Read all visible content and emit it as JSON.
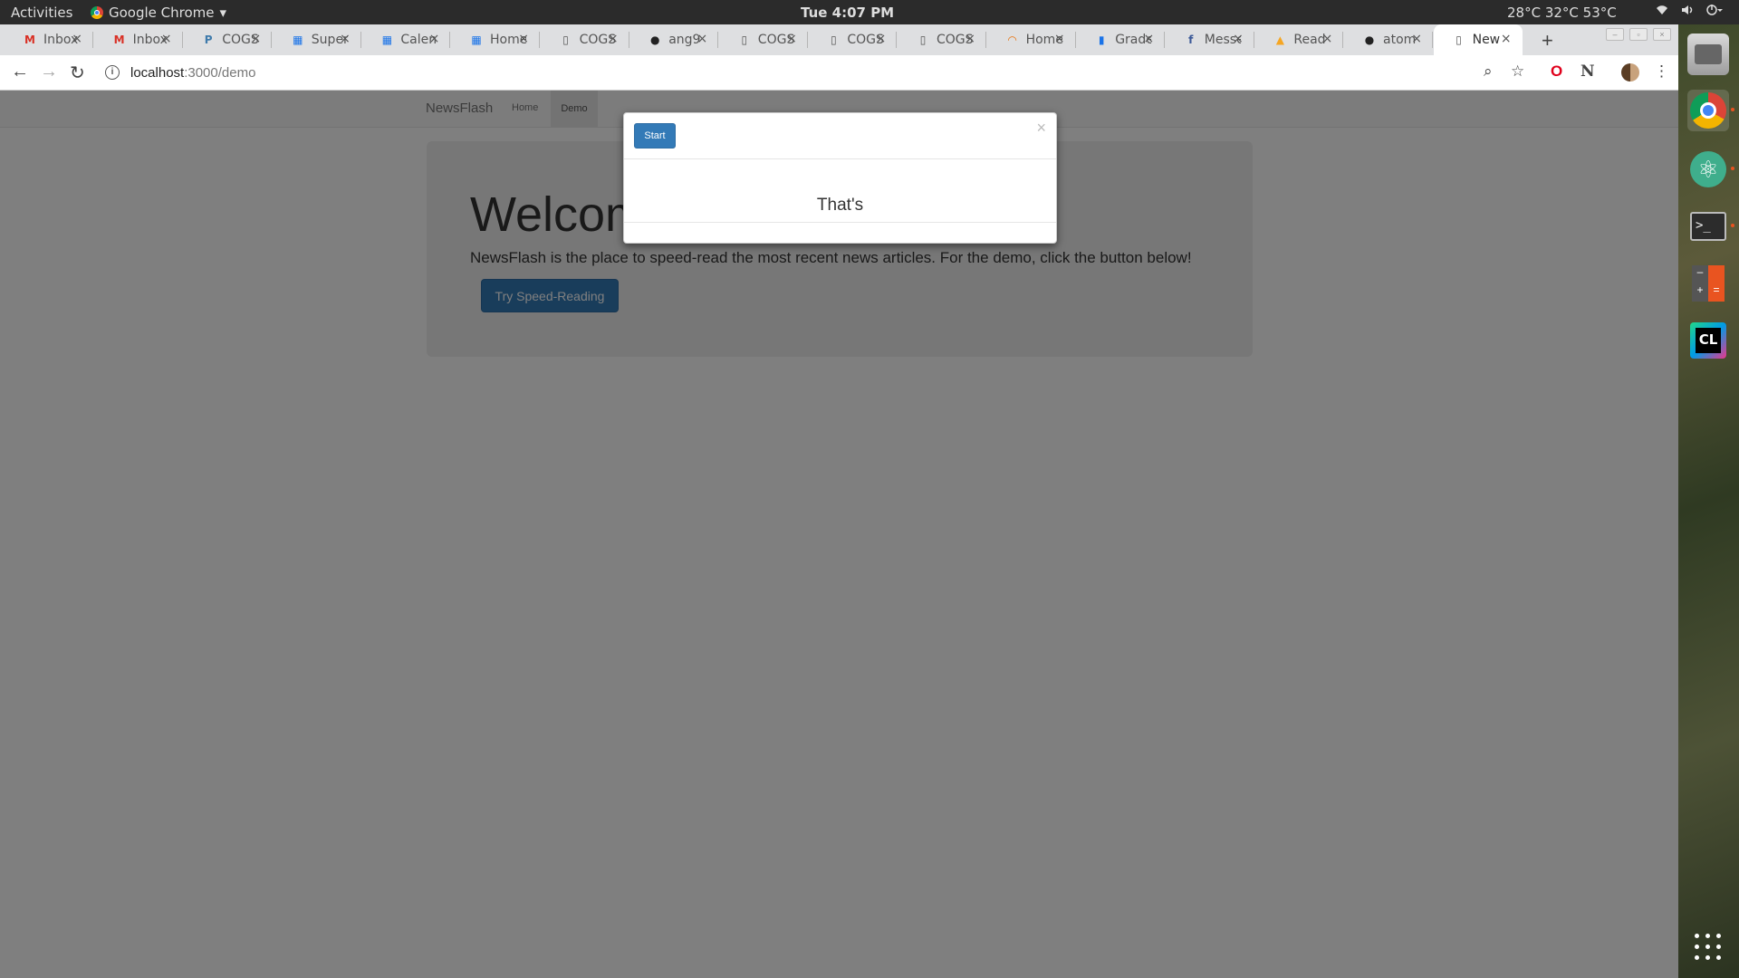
{
  "topbar": {
    "activities": "Activities",
    "app_menu": "Google Chrome",
    "app_menu_arrow": "▾",
    "clock": "Tue  4:07 PM",
    "weather": "28°C 32°C 53°C",
    "icons": [
      "wifi-icon",
      "volume-icon",
      "power-icon"
    ]
  },
  "tabs": [
    {
      "title": "Inbox",
      "icon": "gmail-icon",
      "fav": "M",
      "color": "#d93025"
    },
    {
      "title": "Inbox",
      "icon": "gmail-icon",
      "fav": "M",
      "color": "#d93025"
    },
    {
      "title": "COGS",
      "icon": "piazza-icon",
      "fav": "P",
      "color": "#3e7aab"
    },
    {
      "title": "Super",
      "icon": "sheet-icon",
      "fav": "▦",
      "color": "#1a73e8"
    },
    {
      "title": "Calendar",
      "icon": "calendar-icon",
      "fav": "▦",
      "color": "#1a73e8"
    },
    {
      "title": "Home",
      "icon": "sheet-icon",
      "fav": "▦",
      "color": "#1a73e8"
    },
    {
      "title": "COGS",
      "icon": "document-icon",
      "fav": "▯",
      "color": "#555"
    },
    {
      "title": "ang9",
      "icon": "github-icon",
      "fav": "●",
      "color": "#222"
    },
    {
      "title": "COGS",
      "icon": "document-icon",
      "fav": "▯",
      "color": "#555"
    },
    {
      "title": "COGS",
      "icon": "document-icon",
      "fav": "▯",
      "color": "#555"
    },
    {
      "title": "COGS",
      "icon": "document-icon",
      "fav": "▯",
      "color": "#555"
    },
    {
      "title": "Home",
      "icon": "loading-icon",
      "fav": "◠",
      "color": "#e8710a"
    },
    {
      "title": "Grade",
      "icon": "chart-icon",
      "fav": "▮",
      "color": "#1a73e8"
    },
    {
      "title": "Messenger",
      "icon": "facebook-icon",
      "fav": "f",
      "color": "#3b5998"
    },
    {
      "title": "Read",
      "icon": "firebase-icon",
      "fav": "▲",
      "color": "#f5a623"
    },
    {
      "title": "atom",
      "icon": "github-icon",
      "fav": "●",
      "color": "#222"
    },
    {
      "title": "New",
      "icon": "document-icon",
      "fav": "▯",
      "color": "#555",
      "active": true
    }
  ],
  "address_bar": {
    "host": "localhost",
    "path": ":3000/demo"
  },
  "page": {
    "brand": "NewsFlash",
    "nav_home": "Home",
    "nav_demo": "Demo",
    "heading": "Welcome",
    "intro": "NewsFlash is the place to speed-read the most recent news articles. For the demo, click the button below!",
    "try_button": "Try Speed-Reading"
  },
  "modal": {
    "start_button": "Start",
    "close": "×",
    "word": "That's"
  },
  "colors": {
    "primary": "#337ab7",
    "backdrop": "rgba(0,0,0,0.5)"
  }
}
